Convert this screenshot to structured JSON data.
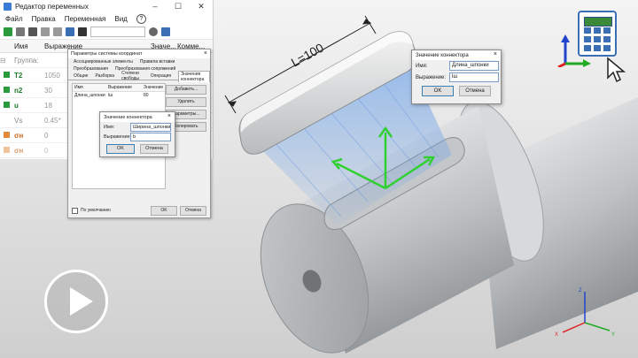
{
  "editor": {
    "title": "Редактор переменных",
    "window_buttons": [
      "–",
      "☐",
      "✕"
    ],
    "menu": [
      "Файл",
      "Правка",
      "Переменная",
      "Вид"
    ],
    "help": "?",
    "columns": [
      "",
      "Имя",
      "Выражение",
      "Значе...",
      "Комме..."
    ],
    "group_label": "Группа:",
    "rows": [
      {
        "name": "T2",
        "expression": "1050"
      },
      {
        "name": "n2",
        "expression": "30"
      },
      {
        "name": "u",
        "expression": "18"
      },
      {
        "name": "Vs",
        "expression": "0.45*"
      },
      {
        "name": "σн",
        "expression": "0"
      },
      {
        "name": "σн",
        "expression": "0"
      }
    ]
  },
  "cs_dialog": {
    "title": "Параметры системы координат",
    "tabs_row1": [
      "Ассоциированные элементы",
      "Правила вставки"
    ],
    "tabs_row2": [
      "Преобразования",
      "Преобразования сопряжений"
    ],
    "tabs_row3": [
      "Общие",
      "Разборка",
      "Степени свободы",
      "Операция",
      "Значения коннектора"
    ],
    "table_headers": [
      "Имя",
      "Выражение",
      "Значение"
    ],
    "table_rows": [
      {
        "name": "Длина_шпонки",
        "expression": "lш",
        "value": "80"
      }
    ],
    "side_buttons": [
      "Добавить...",
      "Удалить",
      "Параметры...",
      "Копировать"
    ],
    "checkbox_label": "По умолчанию",
    "ok": "OK",
    "cancel": "Отмена"
  },
  "connector_dialog_left": {
    "title": "Значение коннектора",
    "name_label": "Имя:",
    "name_value": "Ширина_шпонки",
    "expr_label": "Выражение:",
    "expr_value": "b",
    "ok": "OK",
    "cancel": "Отмена"
  },
  "connector_dialog_right": {
    "title": "Значение коннектора",
    "name_label": "Имя:",
    "name_value": "Длина_шпонки",
    "expr_label": "Выражение:",
    "expr_value": "lш",
    "ok": "OK",
    "cancel": "Отмена"
  },
  "dimension_label": "L=100",
  "axis_labels": {
    "x": "X",
    "y": "Y",
    "z": "Z"
  },
  "colors": {
    "accent": "#3a6fb5",
    "green": "#2a9b3a",
    "axis_red": "#d22",
    "axis_green": "#2a2",
    "axis_blue": "#24c"
  },
  "icons": [
    "calculator-icon",
    "cursor-icon",
    "play-icon",
    "axis-triad-icon"
  ]
}
